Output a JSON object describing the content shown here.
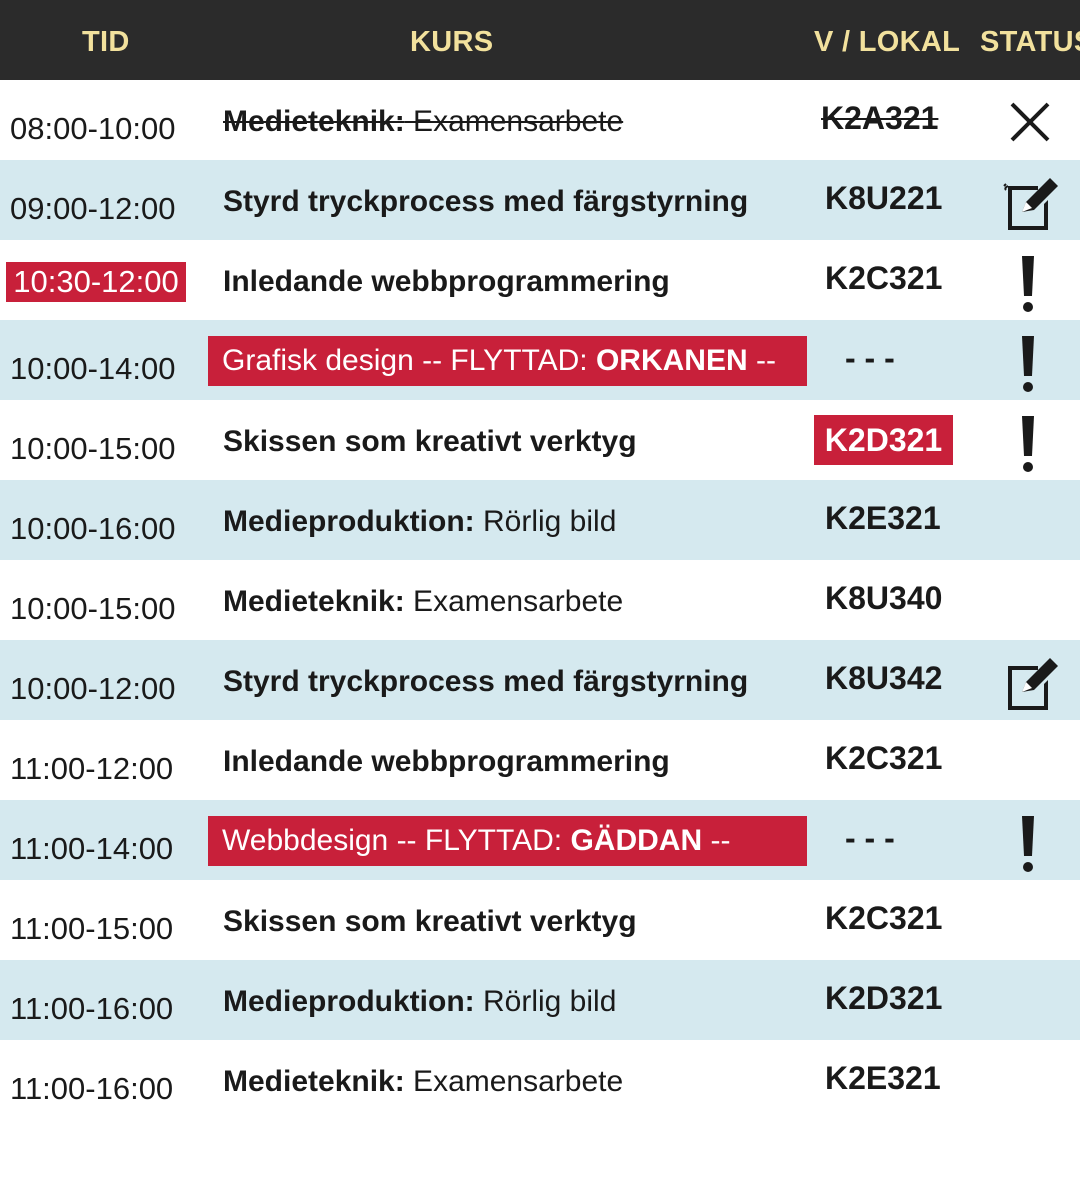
{
  "header": {
    "tid": "TID",
    "kurs": "KURS",
    "lokal": "V / LOKAL",
    "status": "STATUS"
  },
  "rows": [
    {
      "time": "08:00-10:00",
      "course_bold": "Medieteknik:",
      "course_regular": " Examensarbete",
      "room": "K2A321",
      "status": "cancelled-x-icon"
    },
    {
      "time": "09:00-12:00",
      "course_bold": "Styrd tryckprocess med färgstyrning",
      "course_regular": "",
      "room": "K8U221",
      "status": "edit-note-icon"
    },
    {
      "time": "10:30-12:00",
      "course_bold": "Inledande webbprogrammering",
      "course_regular": "",
      "room": "K2C321",
      "status": "exclamation-icon"
    },
    {
      "time": "10:00-14:00",
      "course_regular": "Grafisk design  -- FLYTTAD: ",
      "course_bold": "ORKANEN",
      "course_tail": " --",
      "room": "- - -",
      "status": "exclamation-icon"
    },
    {
      "time": "10:00-15:00",
      "course_bold": "Skissen som kreativt verktyg",
      "course_regular": "",
      "room": "K2D321",
      "status": "exclamation-icon"
    },
    {
      "time": "10:00-16:00",
      "course_bold": "Medieproduktion:",
      "course_regular": " Rörlig bild",
      "room": "K2E321",
      "status": ""
    },
    {
      "time": "10:00-15:00",
      "course_bold": "Medieteknik:",
      "course_regular": " Examensarbete",
      "room": "K8U340",
      "status": ""
    },
    {
      "time": "10:00-12:00",
      "course_bold": "Styrd tryckprocess med färgstyrning",
      "course_regular": "",
      "room": "K8U342",
      "status": "edit-note-icon"
    },
    {
      "time": "11:00-12:00",
      "course_bold": "Inledande webbprogrammering",
      "course_regular": "",
      "room": "K2C321",
      "status": ""
    },
    {
      "time": "11:00-14:00",
      "course_regular": "Webbdesign  -- FLYTTAD: ",
      "course_bold": "GÄDDAN",
      "course_tail": " --",
      "room": "- - -",
      "status": "exclamation-icon"
    },
    {
      "time": "11:00-15:00",
      "course_bold": "Skissen som kreativt verktyg",
      "course_regular": "",
      "room": "K2C321",
      "status": ""
    },
    {
      "time": "11:00-16:00",
      "course_bold": "Medieproduktion:",
      "course_regular": " Rörlig bild",
      "room": "K2D321",
      "status": ""
    },
    {
      "time": "11:00-16:00",
      "course_bold": "Medieteknik:",
      "course_regular": " Examensarbete",
      "room": "K2E321",
      "status": ""
    }
  ],
  "colors": {
    "header_bg": "#2b2b2b",
    "header_text": "#f2e19d",
    "alt_row_bg": "#d5e9ef",
    "highlight_red": "#c8203a"
  }
}
